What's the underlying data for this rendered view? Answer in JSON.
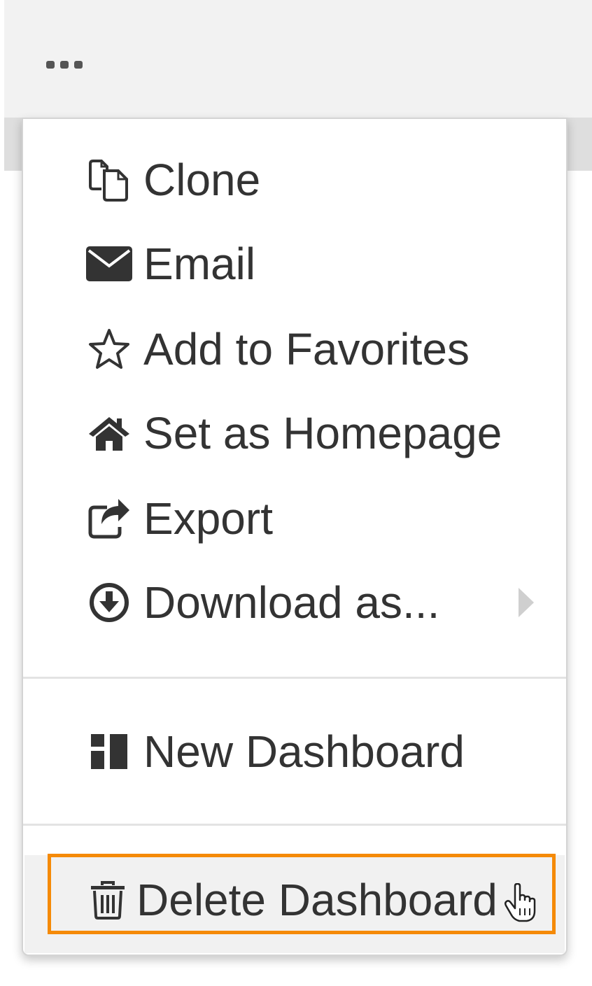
{
  "toolbar": {
    "more_icon": "more-horizontal-icon"
  },
  "menu": {
    "items": [
      {
        "label": "Clone",
        "icon": "clone-icon"
      },
      {
        "label": "Email",
        "icon": "envelope-icon"
      },
      {
        "label": "Add to Favorites",
        "icon": "star-outline-icon"
      },
      {
        "label": "Set as Homepage",
        "icon": "home-icon"
      },
      {
        "label": "Export",
        "icon": "share-icon"
      },
      {
        "label": "Download as...",
        "icon": "download-circle-icon",
        "has_submenu": true
      },
      {
        "label": "New Dashboard",
        "icon": "dashboard-icon"
      },
      {
        "label": "Delete Dashboard",
        "icon": "trash-icon",
        "highlighted": true
      }
    ]
  },
  "colors": {
    "highlight_border": "#f58a07",
    "text": "#333333",
    "icon": "#333333",
    "toolbar_bg": "#f2f2f2"
  },
  "cursor": "pointer-hand-icon"
}
